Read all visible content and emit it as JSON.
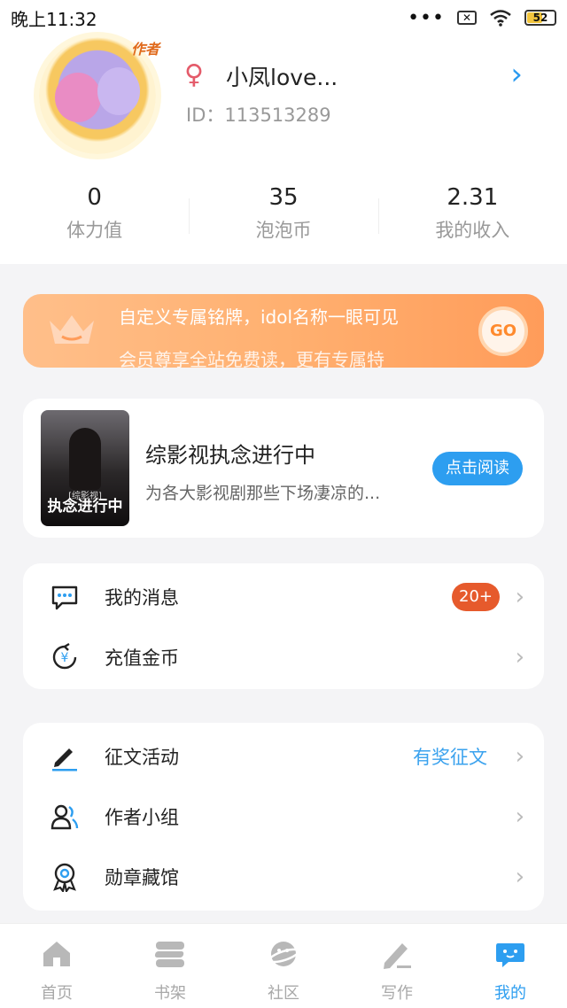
{
  "status_bar": {
    "time": "晚上11:32",
    "battery": "52",
    "icons": [
      "dots-icon",
      "sim-x-icon",
      "wifi-icon",
      "battery-icon"
    ]
  },
  "profile": {
    "avatar_tag": "作者",
    "gender_symbol": "♀",
    "username": "小凤love...",
    "user_id": "ID：113513289",
    "stats": [
      {
        "value": "0",
        "label": "体力值"
      },
      {
        "value": "35",
        "label": "泡泡币"
      },
      {
        "value": "2.31",
        "label": "我的收入"
      }
    ]
  },
  "banner": {
    "text": "自定义专属铭牌，idol名称一眼可见",
    "text_next": "会员尊享全站免费读，更有专属特",
    "go_label": "GO"
  },
  "book": {
    "cover_title": "执念进行中",
    "cover_subtitle": "[综影视]",
    "title": "综影视执念进行中",
    "desc": "为各大影视剧那些下场凄凉的...",
    "read_label": "点击阅读"
  },
  "menu1": [
    {
      "label": "我的消息",
      "icon": "message-icon",
      "badge": "20+"
    },
    {
      "label": "充值金币",
      "icon": "yuan-coin-icon"
    }
  ],
  "menu2": [
    {
      "label": "征文活动",
      "icon": "pen-icon",
      "extra": "有奖征文"
    },
    {
      "label": "作者小组",
      "icon": "group-icon"
    },
    {
      "label": "勋章藏馆",
      "icon": "medal-icon"
    }
  ],
  "bottom_nav": [
    {
      "label": "首页",
      "icon": "home-icon"
    },
    {
      "label": "书架",
      "icon": "bookshelf-icon"
    },
    {
      "label": "社区",
      "icon": "community-icon"
    },
    {
      "label": "写作",
      "icon": "write-icon"
    },
    {
      "label": "我的",
      "icon": "me-icon",
      "active": true
    }
  ],
  "colors": {
    "accent": "#2d9ef0",
    "badge": "#e65a2c",
    "banner": "#ffb070",
    "gender": "#e45b6a"
  }
}
